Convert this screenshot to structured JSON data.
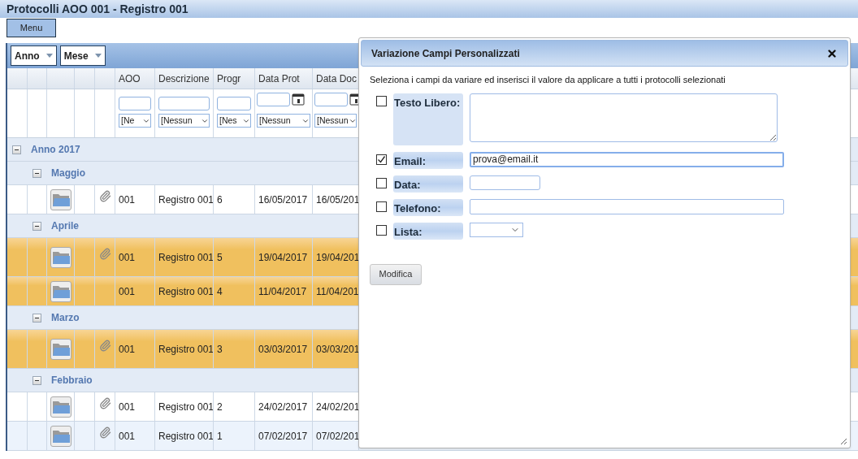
{
  "title": "Protocolli AOO 001 - Registro 001",
  "menu_button": "Menu",
  "group_by": [
    {
      "label": "Anno"
    },
    {
      "label": "Mese"
    }
  ],
  "columns": [
    "AOO",
    "Descrizione",
    "Progr",
    "Data Prot",
    "Data Doc"
  ],
  "filters": [
    {
      "kind": "text",
      "select": "[Ne"
    },
    {
      "kind": "text",
      "select": "[Nessun"
    },
    {
      "kind": "text",
      "select": "[Nes"
    },
    {
      "kind": "date",
      "select": "[Nessun"
    },
    {
      "kind": "date",
      "select": "[Nessun"
    }
  ],
  "groups": [
    {
      "label": "Anno 2017",
      "expanded": true,
      "children": [
        {
          "label": "Maggio",
          "expanded": true,
          "rows": [
            {
              "selected": false,
              "attachment": true,
              "aoo": "001",
              "descrizione": "Registro 001",
              "progr": "6",
              "data_prot": "16/05/2017",
              "data_doc": "16/05/201"
            }
          ]
        },
        {
          "label": "Aprile",
          "expanded": true,
          "rows": [
            {
              "selected": true,
              "attachment": true,
              "aoo": "001",
              "descrizione": "Registro 001",
              "progr": "5",
              "data_prot": "19/04/2017",
              "data_doc": "19/04/201"
            },
            {
              "selected": true,
              "attachment": false,
              "aoo": "001",
              "descrizione": "Registro 001",
              "progr": "4",
              "data_prot": "11/04/2017",
              "data_doc": "11/04/201"
            }
          ]
        },
        {
          "label": "Marzo",
          "expanded": true,
          "rows": [
            {
              "selected": true,
              "attachment": true,
              "aoo": "001",
              "descrizione": "Registro 001",
              "progr": "3",
              "data_prot": "03/03/2017",
              "data_doc": "03/03/201"
            }
          ]
        },
        {
          "label": "Febbraio",
          "expanded": true,
          "rows": [
            {
              "selected": false,
              "attachment": true,
              "aoo": "001",
              "descrizione": "Registro 001",
              "progr": "2",
              "data_prot": "24/02/2017",
              "data_doc": "24/02/201"
            },
            {
              "selected": false,
              "attachment": true,
              "aoo": "001",
              "descrizione": "Registro 001",
              "progr": "1",
              "data_prot": "07/02/2017",
              "data_doc": "07/02/201"
            }
          ]
        }
      ]
    }
  ],
  "dialog": {
    "title": "Variazione Campi Personalizzati",
    "instructions": "Seleziona i campi da variare ed inserisci il valore da applicare a tutti i protocolli selezionati",
    "fields": [
      {
        "kind": "textarea",
        "label": "Testo Libero:",
        "checked": false
      },
      {
        "kind": "text",
        "label": "Email:",
        "checked": true,
        "value": "prova@email.it"
      },
      {
        "kind": "date",
        "label": "Data:",
        "checked": false
      },
      {
        "kind": "text",
        "label": "Telefono:",
        "checked": false
      },
      {
        "kind": "select",
        "label": "Lista:",
        "checked": false
      }
    ],
    "button": "Modifica"
  }
}
